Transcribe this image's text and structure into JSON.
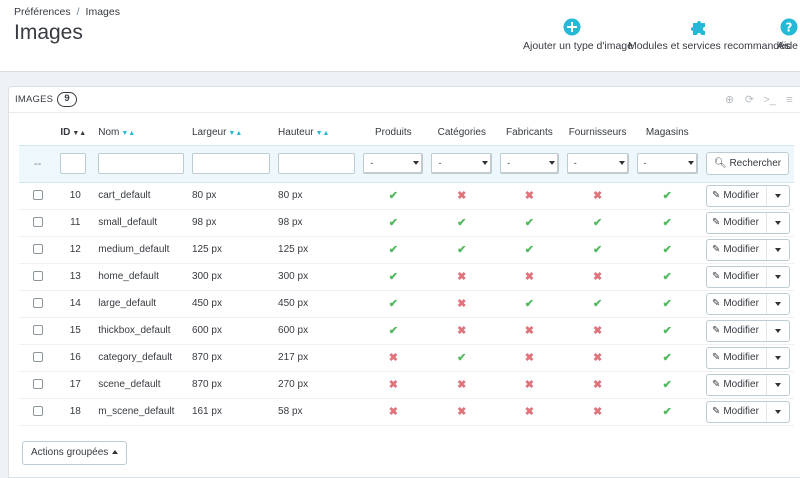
{
  "breadcrumb": {
    "parent": "Préférences",
    "separator": "/",
    "current": "Images"
  },
  "page_title": "Images",
  "toolbar": {
    "add_image_type": {
      "label": "Ajouter un type d'image",
      "icon": "plus-circle-icon"
    },
    "modules": {
      "label": "Modules et services recommandés",
      "icon": "puzzle-icon"
    },
    "help": {
      "label": "Aide",
      "icon": "question-circle-icon"
    }
  },
  "panel": {
    "title": "IMAGES",
    "count": "9",
    "icons": [
      "plus-icon",
      "refresh-icon",
      "terminal-icon",
      "database-icon"
    ]
  },
  "columns": {
    "id": "ID",
    "name": "Nom",
    "width": "Largeur",
    "height": "Hauteur",
    "products": "Produits",
    "categories": "Catégories",
    "manufacturers": "Fabricants",
    "suppliers": "Fournisseurs",
    "stores": "Magasins"
  },
  "filters": {
    "collapse_symbol": "--",
    "select_value": "-",
    "search_label": "Rechercher"
  },
  "rows": [
    {
      "id": "10",
      "name": "cart_default",
      "width": "80 px",
      "height": "80 px",
      "flags": [
        true,
        false,
        false,
        false,
        true
      ]
    },
    {
      "id": "11",
      "name": "small_default",
      "width": "98 px",
      "height": "98 px",
      "flags": [
        true,
        true,
        true,
        true,
        true
      ]
    },
    {
      "id": "12",
      "name": "medium_default",
      "width": "125 px",
      "height": "125 px",
      "flags": [
        true,
        true,
        true,
        true,
        true
      ]
    },
    {
      "id": "13",
      "name": "home_default",
      "width": "300 px",
      "height": "300 px",
      "flags": [
        true,
        false,
        false,
        false,
        true
      ]
    },
    {
      "id": "14",
      "name": "large_default",
      "width": "450 px",
      "height": "450 px",
      "flags": [
        true,
        false,
        true,
        true,
        true
      ]
    },
    {
      "id": "15",
      "name": "thickbox_default",
      "width": "600 px",
      "height": "600 px",
      "flags": [
        true,
        false,
        false,
        false,
        true
      ]
    },
    {
      "id": "16",
      "name": "category_default",
      "width": "870 px",
      "height": "217 px",
      "flags": [
        false,
        true,
        false,
        false,
        true
      ]
    },
    {
      "id": "17",
      "name": "scene_default",
      "width": "870 px",
      "height": "270 px",
      "flags": [
        false,
        false,
        false,
        false,
        true
      ]
    },
    {
      "id": "18",
      "name": "m_scene_default",
      "width": "161 px",
      "height": "58 px",
      "flags": [
        false,
        false,
        false,
        false,
        true
      ]
    }
  ],
  "row_action": {
    "label": "Modifier",
    "icon": "pencil-icon"
  },
  "flag_symbols": {
    "yes": "✔",
    "no": "✖"
  },
  "bulk_actions": {
    "label": "Actions groupées"
  },
  "colors": {
    "accent": "#25b9d7",
    "check": "#53b960",
    "cross": "#e2727b",
    "text": "#363a41",
    "background": "#eef1f5"
  }
}
